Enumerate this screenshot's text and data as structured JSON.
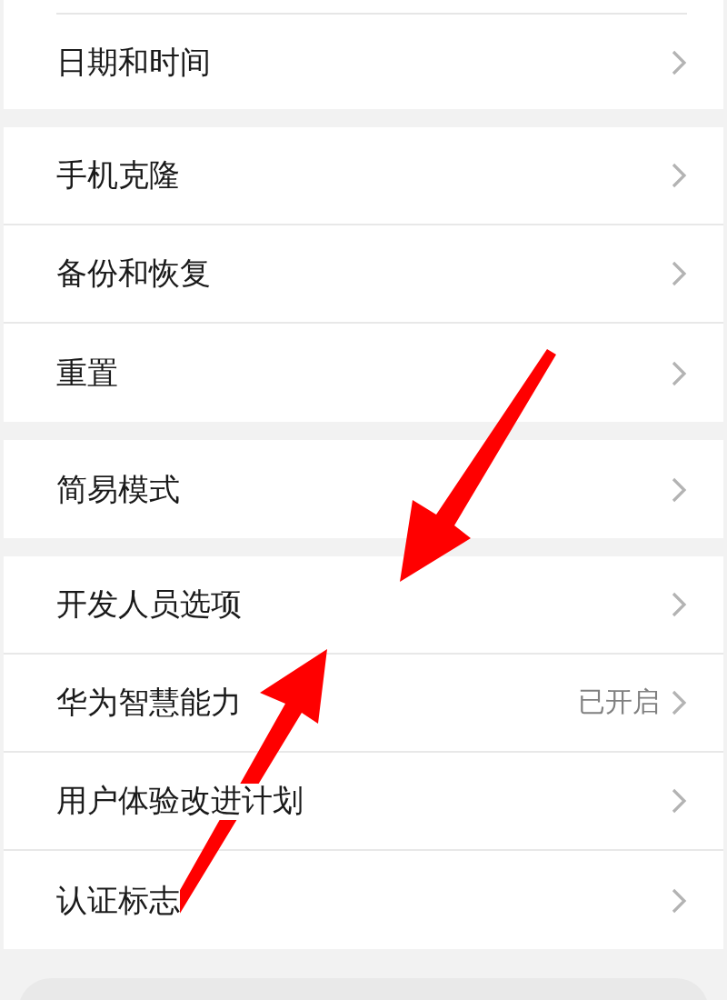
{
  "sections": [
    {
      "items": [
        {
          "label": "日期和时间"
        }
      ]
    },
    {
      "items": [
        {
          "label": "手机克隆"
        },
        {
          "label": "备份和恢复"
        },
        {
          "label": "重置"
        }
      ]
    },
    {
      "items": [
        {
          "label": "简易模式"
        }
      ]
    },
    {
      "items": [
        {
          "label": "开发人员选项"
        },
        {
          "label": "华为智慧能力",
          "value": "已开启"
        },
        {
          "label": "用户体验改进计划"
        },
        {
          "label": "认证标志"
        }
      ]
    }
  ]
}
